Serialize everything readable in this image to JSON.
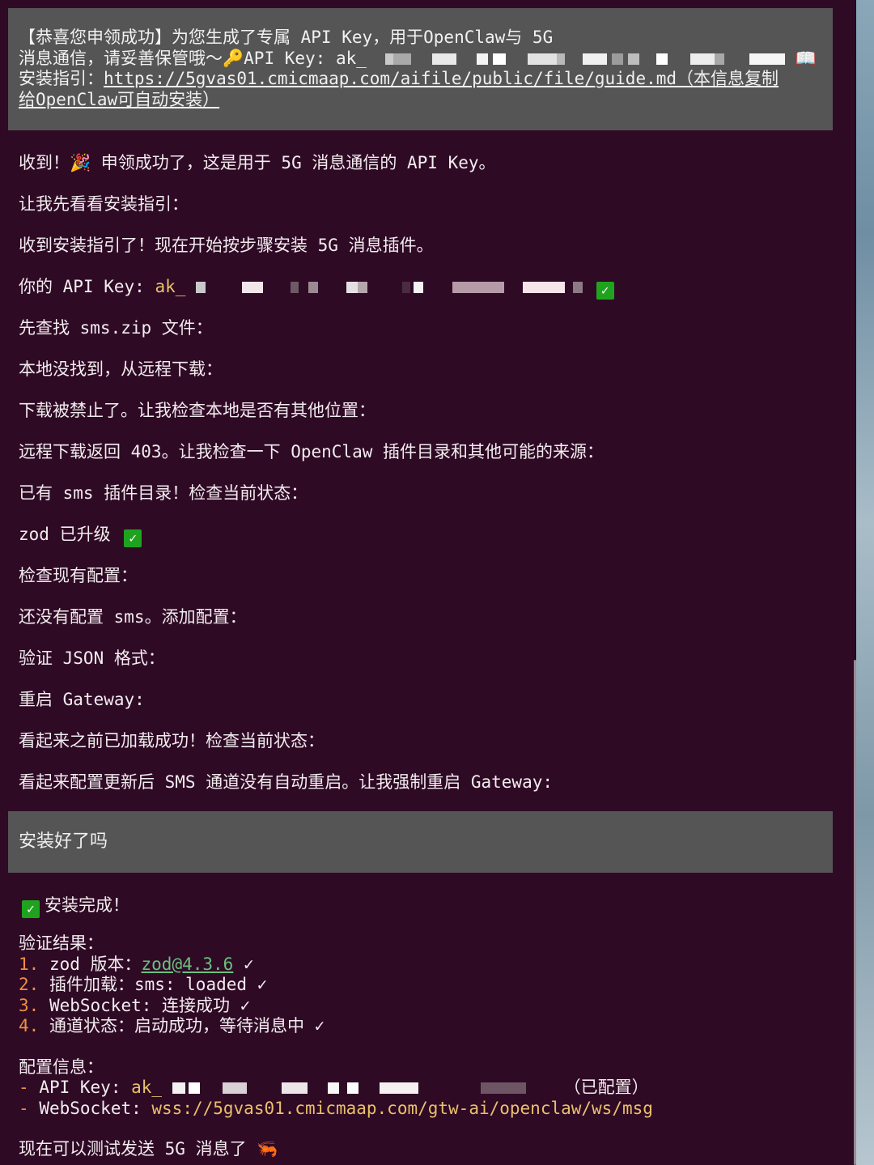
{
  "user_message_1": {
    "line1": "【恭喜您申领成功】为您生成了专属 API Key，用于OpenClaw与 5G",
    "line2_prefix": "消息通信，请妥善保管哦～",
    "line2_key_label": "API Key: ak_",
    "line3_prefix": "安装指引：",
    "guide_link_line1": "https://5gvas01.cmicmaap.com/aifile/public/file/guide.md（本信息复制",
    "guide_link_line2": "给OpenClaw可自动安装）"
  },
  "assistant_lines": {
    "l1": "收到！🎉 申领成功了，这是用于 5G 消息通信的 API Key。",
    "l2": "让我先看看安装指引：",
    "l3": "收到安装指引了！现在开始按步骤安装 5G 消息插件。",
    "l4_label": "你的 API Key: ",
    "l4_key": "ak_",
    "l5": "先查找 sms.zip 文件：",
    "l6": "本地没找到，从远程下载：",
    "l7": "下载被禁止了。让我检查本地是否有其他位置：",
    "l8": "远程下载返回 403。让我检查一下 OpenClaw 插件目录和其他可能的来源：",
    "l9": "已有 sms 插件目录！检查当前状态：",
    "l10": "zod 已升级 ",
    "l11": "检查现有配置：",
    "l12": "还没有配置 sms。添加配置：",
    "l13": "验证 JSON 格式：",
    "l14": "重启 Gateway:",
    "l15": "看起来之前已加载成功！检查当前状态：",
    "l16": "看起来配置更新后 SMS 通道没有自动重启。让我强制重启 Gateway:"
  },
  "user_message_2": "安装好了吗",
  "final": {
    "title": "安装完成！",
    "verify_header": "验证结果：",
    "items": [
      {
        "num": "1.",
        "pre": " zod 版本：",
        "link": "zod@4.3.6",
        "post": " ✓"
      },
      {
        "num": "2.",
        "pre": " 插件加载：sms: loaded ✓",
        "link": "",
        "post": ""
      },
      {
        "num": "3.",
        "pre": " WebSocket: 连接成功 ✓",
        "link": "",
        "post": ""
      },
      {
        "num": "4.",
        "pre": " 通道状态：启动成功，等待消息中 ✓",
        "link": "",
        "post": ""
      }
    ],
    "config_header": "配置信息：",
    "config_key_label": "API Key: ",
    "config_key_value": "ak_",
    "config_key_status": "（已配置）",
    "config_ws_label": "WebSocket: ",
    "config_ws_value": "wss://5gvas01.cmicmaap.com/gtw-ai/openclaw/ws/msg",
    "last_line": "现在可以测试发送 5G 消息了 🦐",
    "dash": "-"
  },
  "icons": {
    "key": "key-icon",
    "book": "book-icon",
    "party": "party-popper-icon",
    "check": "check-mark-icon",
    "shrimp": "shrimp-icon"
  },
  "colors": {
    "background": "#2f0a25",
    "user_box": "#555555",
    "key_text": "#e6c36a",
    "number": "#ef8f3f",
    "link_green": "#6ac17e",
    "check_green": "#1fa31f"
  }
}
